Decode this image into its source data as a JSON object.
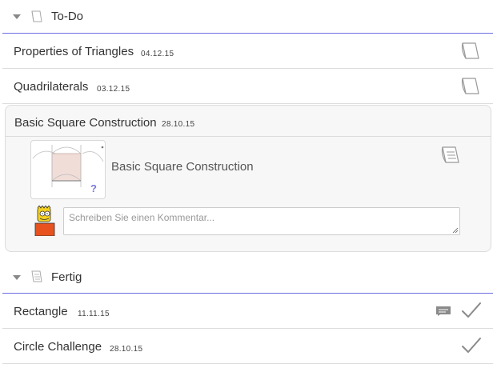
{
  "todo": {
    "title": "To-Do",
    "items": [
      {
        "title": "Properties of Triangles",
        "date": "04.12.15"
      },
      {
        "title": "Quadrilaterals",
        "date": "03.12.15"
      }
    ],
    "expanded": {
      "title": "Basic Square Construction",
      "date": "28.10.15",
      "material_title": "Basic Square Construction",
      "thumbnail_badge": "?",
      "comment_placeholder": "Schreiben Sie einen Kommentar..."
    }
  },
  "done": {
    "title": "Fertig",
    "items": [
      {
        "title": "Rectangle",
        "date": "11.11.15"
      },
      {
        "title": "Circle Challenge",
        "date": "28.10.15"
      }
    ]
  },
  "colors": {
    "divider_accent": "#6c6ce0",
    "check": "#8a8a8a",
    "badge": "#7a7ad8"
  }
}
